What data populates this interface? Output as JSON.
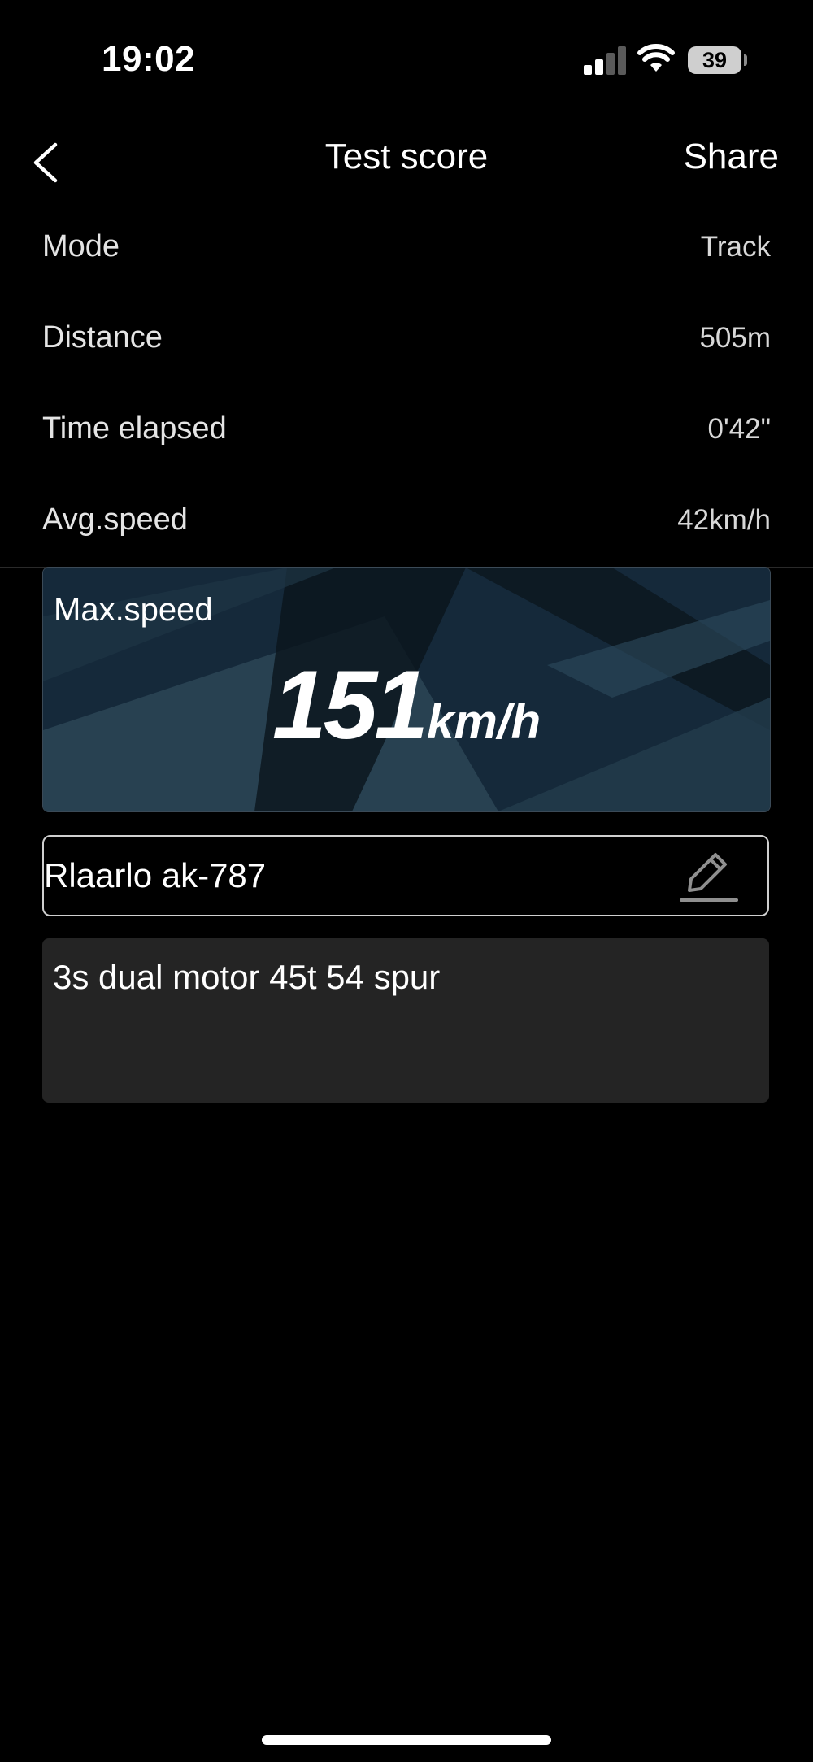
{
  "status_bar": {
    "time": "19:02",
    "battery": "39",
    "icons": [
      "signal-icon",
      "wifi-icon",
      "battery-icon"
    ]
  },
  "nav": {
    "back_icon": "chevron-left-icon",
    "title": "Test score",
    "share_label": "Share"
  },
  "rows": [
    {
      "label": "Mode",
      "value": "Track"
    },
    {
      "label": "Distance",
      "value": "505m"
    },
    {
      "label": "Time elapsed",
      "value": "0'42\""
    },
    {
      "label": "Avg.speed",
      "value": "42km/h"
    }
  ],
  "max_speed": {
    "label": "Max.speed",
    "value": "151",
    "unit": "km/h"
  },
  "name_field": {
    "value": "Rlaarlo ak-787",
    "edit_icon": "edit-pencil-icon"
  },
  "notes": {
    "value": "3s dual motor 45t 54 spur"
  },
  "colors": {
    "background": "#000000",
    "card_background": "#132430",
    "notes_background": "#242424",
    "text": "#ffffff"
  }
}
